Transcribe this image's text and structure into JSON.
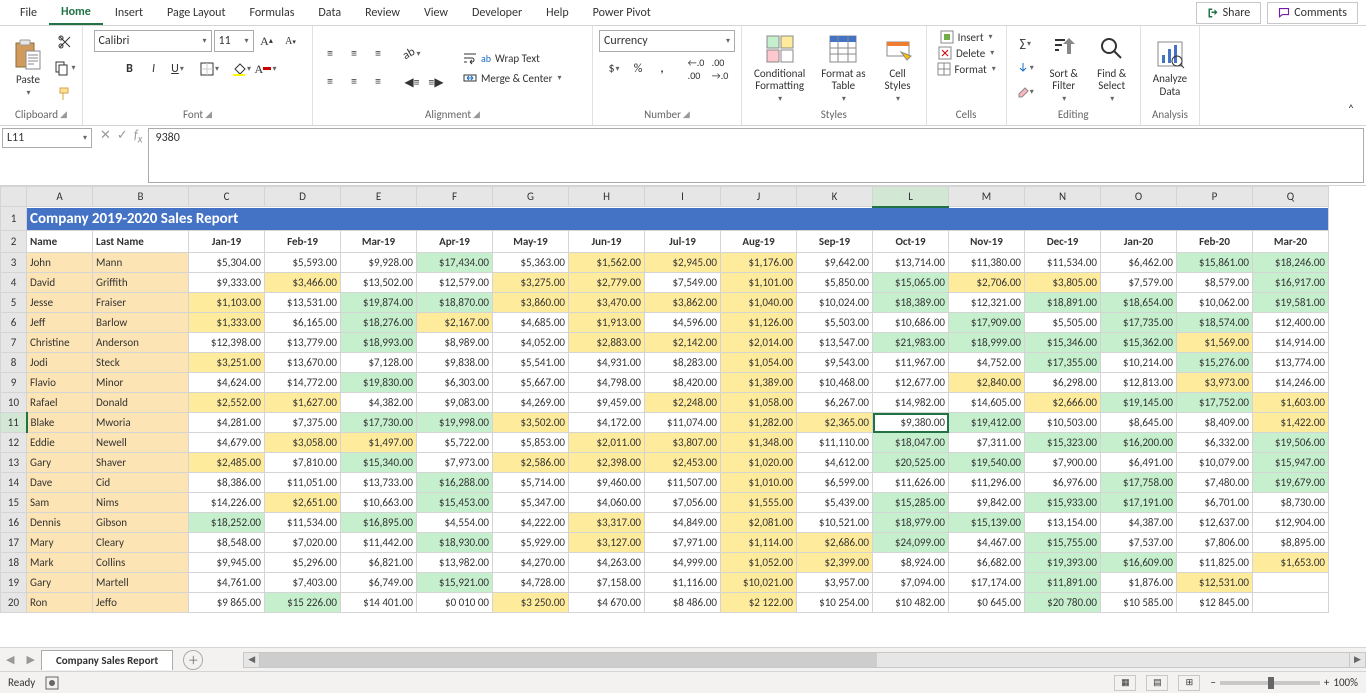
{
  "menu": {
    "tabs": [
      "File",
      "Home",
      "Insert",
      "Page Layout",
      "Formulas",
      "Data",
      "Review",
      "View",
      "Developer",
      "Help",
      "Power Pivot"
    ],
    "active": "Home",
    "share": "Share",
    "comments": "Comments"
  },
  "ribbon": {
    "clipboard": {
      "paste": "Paste",
      "label": "Clipboard"
    },
    "font": {
      "name": "Calibri",
      "size": "11",
      "label": "Font"
    },
    "alignment": {
      "wrap": "Wrap Text",
      "merge": "Merge & Center",
      "label": "Alignment"
    },
    "number": {
      "format": "Currency",
      "label": "Number"
    },
    "styles": {
      "cond": "Conditional\nFormatting",
      "fmt": "Format as\nTable",
      "cell": "Cell\nStyles",
      "label": "Styles"
    },
    "cells": {
      "insert": "Insert",
      "delete": "Delete",
      "format": "Format",
      "label": "Cells"
    },
    "editing": {
      "sort": "Sort &\nFilter",
      "find": "Find &\nSelect",
      "label": "Editing"
    },
    "analysis": {
      "analyze": "Analyze\nData",
      "label": "Analysis"
    }
  },
  "formula": {
    "cell": "L11",
    "value": "9380"
  },
  "sheet": {
    "title": "Company 2019-2020 Sales Report",
    "cols": [
      "A",
      "B",
      "C",
      "D",
      "E",
      "F",
      "G",
      "H",
      "I",
      "J",
      "K",
      "L",
      "M",
      "N",
      "O",
      "P",
      "Q"
    ],
    "activeCol": "L",
    "activeRow": 11,
    "widths": [
      66,
      96,
      76,
      76,
      76,
      76,
      76,
      76,
      76,
      76,
      76,
      76,
      76,
      76,
      76,
      76,
      76
    ],
    "headers": [
      "Name",
      "Last Name",
      "Jan-19",
      "Feb-19",
      "Mar-19",
      "Apr-19",
      "May-19",
      "Jun-19",
      "Jul-19",
      "Aug-19",
      "Sep-19",
      "Oct-19",
      "Nov-19",
      "Dec-19",
      "Jan-20",
      "Feb-20",
      "Mar-20"
    ],
    "rows": [
      {
        "r": 3,
        "first": "John",
        "last": "Mann",
        "v": [
          "$5,304.00",
          "$5,593.00",
          "$9,928.00",
          "$17,434.00",
          "$5,363.00",
          "$1,562.00",
          "$2,945.00",
          "$1,176.00",
          "$9,642.00",
          "$13,714.00",
          "$11,380.00",
          "$11,534.00",
          "$6,462.00",
          "$15,861.00",
          "$18,246.00"
        ],
        "c": [
          "",
          "",
          "",
          "g",
          "",
          "y",
          "y",
          "y",
          "",
          "",
          "",
          "",
          "",
          "g",
          "g"
        ]
      },
      {
        "r": 4,
        "first": "David",
        "last": "Griffith",
        "v": [
          "$9,333.00",
          "$3,466.00",
          "$13,502.00",
          "$12,579.00",
          "$3,275.00",
          "$2,779.00",
          "$7,549.00",
          "$1,101.00",
          "$5,850.00",
          "$15,065.00",
          "$2,706.00",
          "$3,805.00",
          "$7,579.00",
          "$8,579.00",
          "$16,917.00"
        ],
        "c": [
          "",
          "y",
          "",
          "",
          "y",
          "y",
          "",
          "y",
          "",
          "g",
          "y",
          "y",
          "",
          "",
          "g"
        ]
      },
      {
        "r": 5,
        "first": "Jesse",
        "last": "Fraiser",
        "v": [
          "$1,103.00",
          "$13,531.00",
          "$19,874.00",
          "$18,870.00",
          "$3,860.00",
          "$3,470.00",
          "$3,862.00",
          "$1,040.00",
          "$10,024.00",
          "$18,389.00",
          "$12,321.00",
          "$18,891.00",
          "$18,654.00",
          "$10,062.00",
          "$19,581.00"
        ],
        "c": [
          "y",
          "",
          "g",
          "g",
          "y",
          "y",
          "y",
          "y",
          "",
          "g",
          "",
          "g",
          "g",
          "",
          "g"
        ]
      },
      {
        "r": 6,
        "first": "Jeff",
        "last": "Barlow",
        "v": [
          "$1,333.00",
          "$6,165.00",
          "$18,276.00",
          "$2,167.00",
          "$4,685.00",
          "$1,913.00",
          "$4,596.00",
          "$1,126.00",
          "$5,503.00",
          "$10,686.00",
          "$17,909.00",
          "$5,505.00",
          "$17,735.00",
          "$18,574.00",
          "$12,400.00"
        ],
        "c": [
          "y",
          "",
          "g",
          "y",
          "",
          "y",
          "",
          "y",
          "",
          "",
          "g",
          "",
          "g",
          "g",
          ""
        ]
      },
      {
        "r": 7,
        "first": "Christine",
        "last": "Anderson",
        "v": [
          "$12,398.00",
          "$13,779.00",
          "$18,993.00",
          "$8,989.00",
          "$4,052.00",
          "$2,883.00",
          "$2,142.00",
          "$2,014.00",
          "$13,547.00",
          "$21,983.00",
          "$18,999.00",
          "$15,346.00",
          "$15,362.00",
          "$1,569.00",
          "$14,914.00"
        ],
        "c": [
          "",
          "",
          "g",
          "",
          "",
          "y",
          "y",
          "y",
          "",
          "g",
          "g",
          "g",
          "g",
          "y",
          ""
        ]
      },
      {
        "r": 8,
        "first": "Jodi",
        "last": "Steck",
        "v": [
          "$3,251.00",
          "$13,670.00",
          "$7,128.00",
          "$9,838.00",
          "$5,541.00",
          "$4,931.00",
          "$8,283.00",
          "$1,054.00",
          "$9,543.00",
          "$11,967.00",
          "$4,752.00",
          "$17,355.00",
          "$10,214.00",
          "$15,276.00",
          "$13,774.00"
        ],
        "c": [
          "y",
          "",
          "",
          "",
          "",
          "",
          "",
          "y",
          "",
          "",
          "",
          "g",
          "",
          "g",
          ""
        ]
      },
      {
        "r": 9,
        "first": "Flavio",
        "last": "Minor",
        "v": [
          "$4,624.00",
          "$14,772.00",
          "$19,830.00",
          "$6,303.00",
          "$5,667.00",
          "$4,798.00",
          "$8,420.00",
          "$1,389.00",
          "$10,468.00",
          "$12,677.00",
          "$2,840.00",
          "$6,298.00",
          "$12,813.00",
          "$3,973.00",
          "$14,246.00"
        ],
        "c": [
          "",
          "",
          "g",
          "",
          "",
          "",
          "",
          "y",
          "",
          "",
          "y",
          "",
          "",
          "y",
          ""
        ]
      },
      {
        "r": 10,
        "first": "Rafael",
        "last": "Donald",
        "v": [
          "$2,552.00",
          "$1,627.00",
          "$4,382.00",
          "$9,083.00",
          "$4,269.00",
          "$9,459.00",
          "$2,248.00",
          "$1,058.00",
          "$6,267.00",
          "$14,982.00",
          "$14,605.00",
          "$2,666.00",
          "$19,145.00",
          "$17,752.00",
          "$1,603.00"
        ],
        "c": [
          "y",
          "y",
          "",
          "",
          "",
          "",
          "y",
          "y",
          "",
          "",
          "",
          "y",
          "g",
          "g",
          "y"
        ]
      },
      {
        "r": 11,
        "first": "Blake",
        "last": "Mworia",
        "v": [
          "$4,281.00",
          "$7,375.00",
          "$17,730.00",
          "$19,998.00",
          "$3,502.00",
          "$4,172.00",
          "$11,074.00",
          "$1,282.00",
          "$2,365.00",
          "$9,380.00",
          "$19,412.00",
          "$10,503.00",
          "$8,645.00",
          "$8,409.00",
          "$1,422.00"
        ],
        "c": [
          "",
          "",
          "g",
          "g",
          "y",
          "",
          "",
          "y",
          "y",
          "",
          "g",
          "",
          "",
          "",
          "y"
        ]
      },
      {
        "r": 12,
        "first": "Eddie",
        "last": "Newell",
        "v": [
          "$4,679.00",
          "$3,058.00",
          "$1,497.00",
          "$5,722.00",
          "$5,853.00",
          "$2,011.00",
          "$3,807.00",
          "$1,348.00",
          "$11,110.00",
          "$18,047.00",
          "$7,311.00",
          "$15,323.00",
          "$16,200.00",
          "$6,332.00",
          "$19,506.00"
        ],
        "c": [
          "",
          "y",
          "y",
          "",
          "",
          "y",
          "y",
          "y",
          "",
          "g",
          "",
          "g",
          "g",
          "",
          "g"
        ]
      },
      {
        "r": 13,
        "first": "Gary",
        "last": "Shaver",
        "v": [
          "$2,485.00",
          "$7,810.00",
          "$15,340.00",
          "$7,973.00",
          "$2,586.00",
          "$2,398.00",
          "$2,453.00",
          "$1,020.00",
          "$4,612.00",
          "$20,525.00",
          "$19,540.00",
          "$7,900.00",
          "$6,491.00",
          "$10,079.00",
          "$15,947.00"
        ],
        "c": [
          "y",
          "",
          "g",
          "",
          "y",
          "y",
          "y",
          "y",
          "",
          "g",
          "g",
          "",
          "",
          "",
          "g"
        ]
      },
      {
        "r": 14,
        "first": "Dave",
        "last": "Cid",
        "v": [
          "$8,386.00",
          "$11,051.00",
          "$13,733.00",
          "$16,288.00",
          "$5,714.00",
          "$9,460.00",
          "$11,507.00",
          "$1,010.00",
          "$6,599.00",
          "$11,626.00",
          "$11,296.00",
          "$6,976.00",
          "$17,758.00",
          "$7,480.00",
          "$19,679.00"
        ],
        "c": [
          "",
          "",
          "",
          "g",
          "",
          "",
          "",
          "y",
          "",
          "",
          "",
          "",
          "g",
          "",
          "g"
        ]
      },
      {
        "r": 15,
        "first": "Sam",
        "last": "Nims",
        "v": [
          "$14,226.00",
          "$2,651.00",
          "$10,663.00",
          "$15,453.00",
          "$5,347.00",
          "$4,060.00",
          "$7,056.00",
          "$1,555.00",
          "$5,439.00",
          "$15,285.00",
          "$9,842.00",
          "$15,933.00",
          "$17,191.00",
          "$6,701.00",
          "$8,730.00"
        ],
        "c": [
          "",
          "y",
          "",
          "g",
          "",
          "",
          "",
          "y",
          "",
          "g",
          "",
          "g",
          "g",
          "",
          ""
        ]
      },
      {
        "r": 16,
        "first": "Dennis",
        "last": "Gibson",
        "v": [
          "$18,252.00",
          "$11,534.00",
          "$16,895.00",
          "$4,554.00",
          "$4,222.00",
          "$3,317.00",
          "$4,849.00",
          "$2,081.00",
          "$10,521.00",
          "$18,979.00",
          "$15,139.00",
          "$13,154.00",
          "$4,387.00",
          "$12,637.00",
          "$12,904.00"
        ],
        "c": [
          "g",
          "",
          "g",
          "",
          "",
          "y",
          "",
          "y",
          "",
          "g",
          "g",
          "",
          "",
          "",
          ""
        ]
      },
      {
        "r": 17,
        "first": "Mary",
        "last": "Cleary",
        "v": [
          "$8,548.00",
          "$7,020.00",
          "$11,442.00",
          "$18,930.00",
          "$5,929.00",
          "$3,127.00",
          "$7,971.00",
          "$1,114.00",
          "$2,686.00",
          "$24,099.00",
          "$4,467.00",
          "$15,755.00",
          "$7,537.00",
          "$7,806.00",
          "$8,895.00"
        ],
        "c": [
          "",
          "",
          "",
          "g",
          "",
          "y",
          "",
          "y",
          "y",
          "g",
          "",
          "g",
          "",
          "",
          ""
        ]
      },
      {
        "r": 18,
        "first": "Mark",
        "last": "Collins",
        "v": [
          "$9,945.00",
          "$5,296.00",
          "$6,821.00",
          "$13,982.00",
          "$4,270.00",
          "$4,263.00",
          "$4,999.00",
          "$1,052.00",
          "$2,399.00",
          "$8,924.00",
          "$6,682.00",
          "$19,393.00",
          "$16,609.00",
          "$11,825.00",
          "$1,653.00"
        ],
        "c": [
          "",
          "",
          "",
          "",
          "",
          "",
          "",
          "y",
          "y",
          "",
          "",
          "g",
          "g",
          "",
          "y"
        ]
      },
      {
        "r": 19,
        "first": "Gary",
        "last": "Martell",
        "v": [
          "$4,761.00",
          "$7,403.00",
          "$6,749.00",
          "$15,921.00",
          "$4,728.00",
          "$7,158.00",
          "$1,116.00",
          "$10,021.00",
          "$3,957.00",
          "$7,094.00",
          "$17,174.00",
          "$11,891.00",
          "$1,876.00",
          "$12,531.00"
        ],
        "c": [
          "",
          "",
          "",
          "g",
          "",
          "",
          "",
          "y",
          "",
          "",
          "",
          "g",
          "",
          "y",
          ""
        ]
      },
      {
        "r": 20,
        "first": "Ron",
        "last": "Jeffo",
        "v": [
          "$9 865.00",
          "$15 226.00",
          "$14 401.00",
          "$0 010 00",
          "$3 250.00",
          "$4 670.00",
          "$8 486.00",
          "$2 122.00",
          "$10 254.00",
          "$10 482.00",
          "$0 645.00",
          "$20 780.00",
          "$10 585.00",
          "$12 845.00"
        ],
        "c": [
          "",
          "g",
          "",
          "",
          "y",
          "",
          "",
          "y",
          "",
          "",
          "",
          "g",
          "",
          ""
        ]
      }
    ]
  },
  "tabs": {
    "name": "Company Sales Report"
  },
  "status": {
    "ready": "Ready",
    "zoom": "100%"
  }
}
